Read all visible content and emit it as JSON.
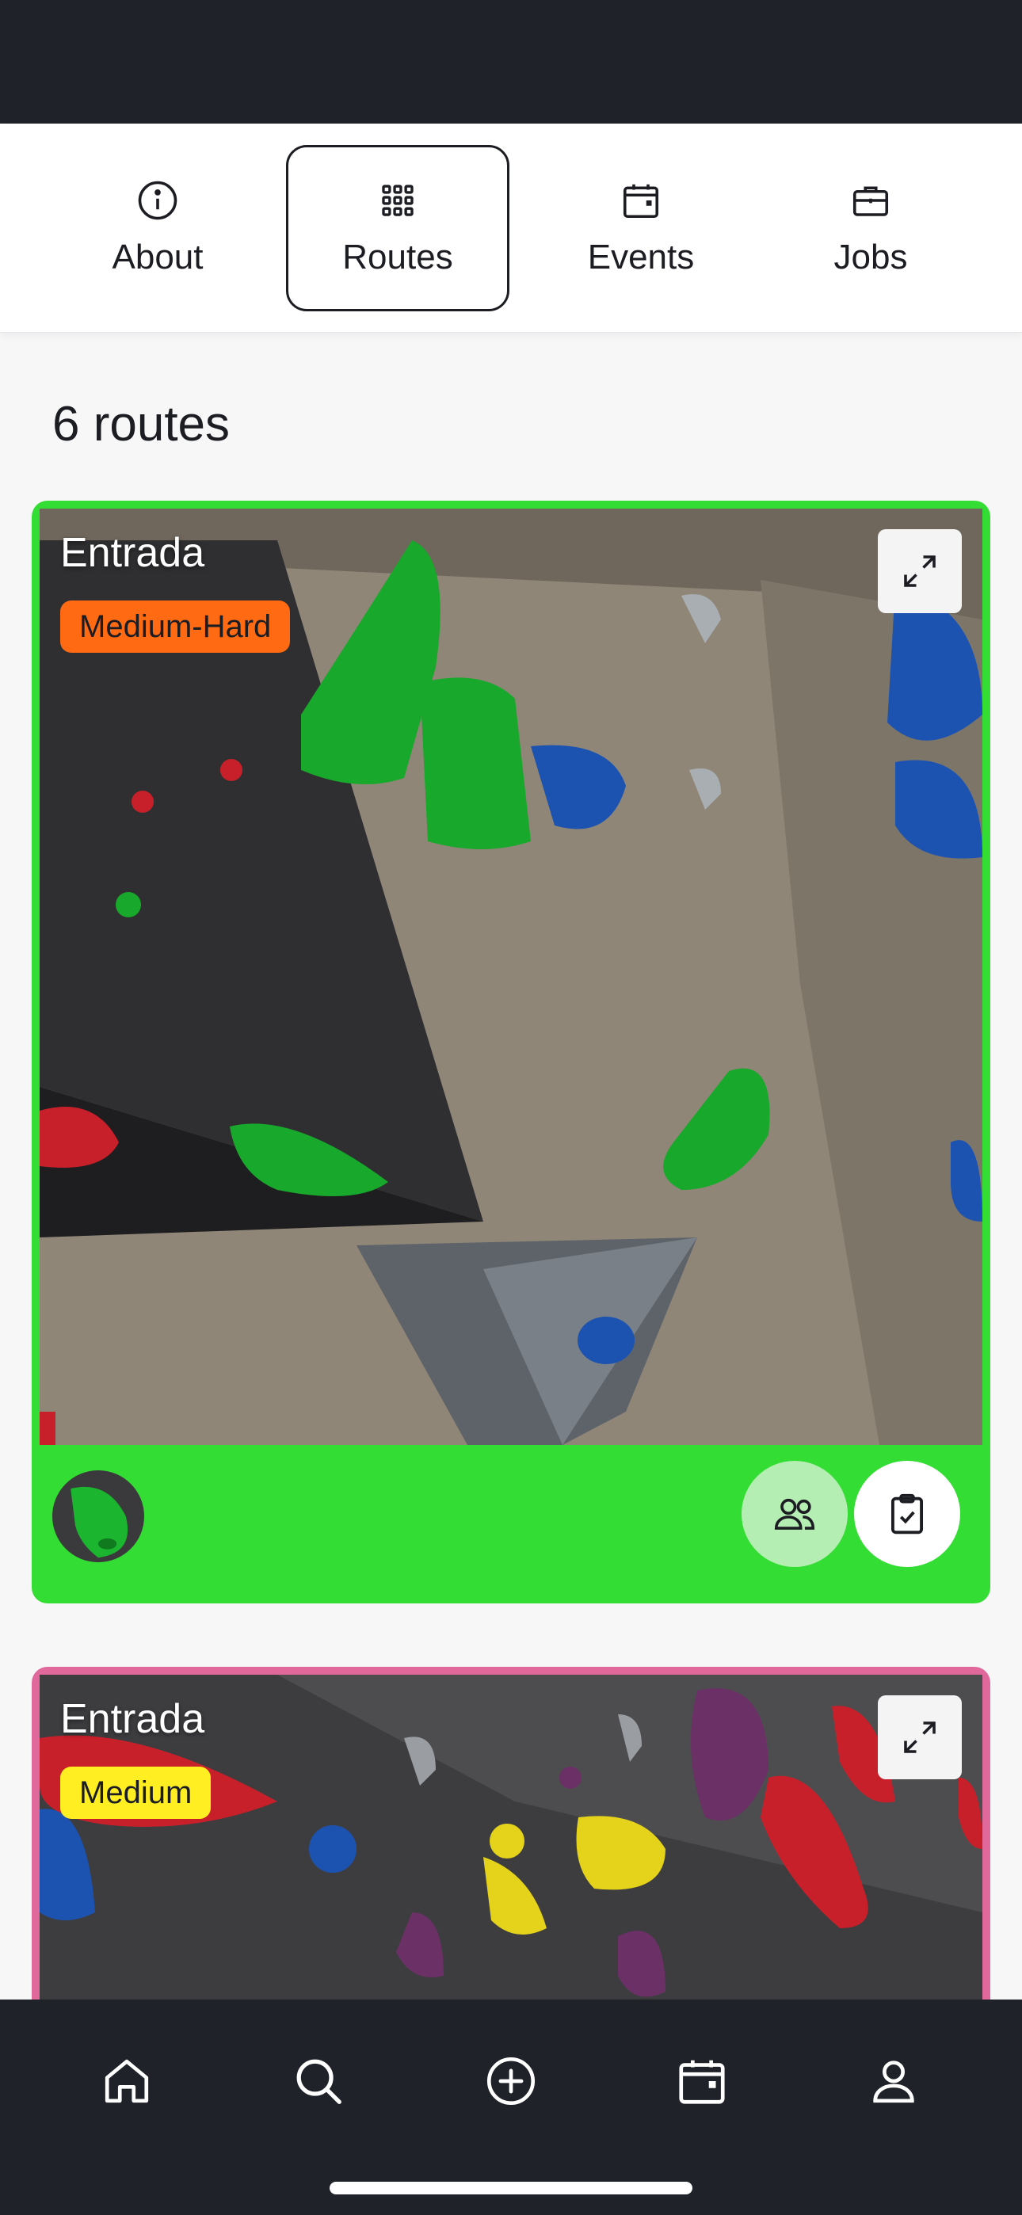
{
  "tabs": [
    {
      "label": "About",
      "icon": "info-icon",
      "active": false
    },
    {
      "label": "Routes",
      "icon": "grid-icon",
      "active": true
    },
    {
      "label": "Events",
      "icon": "calendar-icon",
      "active": false
    },
    {
      "label": "Jobs",
      "icon": "briefcase-icon",
      "active": false
    }
  ],
  "routes_header": {
    "count_label": "6 routes"
  },
  "routes": [
    {
      "name": "Entrada",
      "difficulty": "Medium-Hard",
      "difficulty_color": "#ff6a13",
      "hold_color": "#33dd33"
    },
    {
      "name": "Entrada",
      "difficulty": "Medium",
      "difficulty_color": "#ffee22",
      "hold_color": "#e0689a"
    }
  ],
  "card_actions": [
    "group-icon",
    "clipboard-check-icon"
  ],
  "bottom_nav": [
    {
      "icon": "home-icon"
    },
    {
      "icon": "search-icon"
    },
    {
      "icon": "add-circle-icon"
    },
    {
      "icon": "calendar-icon"
    },
    {
      "icon": "profile-icon"
    }
  ],
  "colors": {
    "dark_bar": "#20222a",
    "footer_group_button": "#b5eeb3"
  }
}
